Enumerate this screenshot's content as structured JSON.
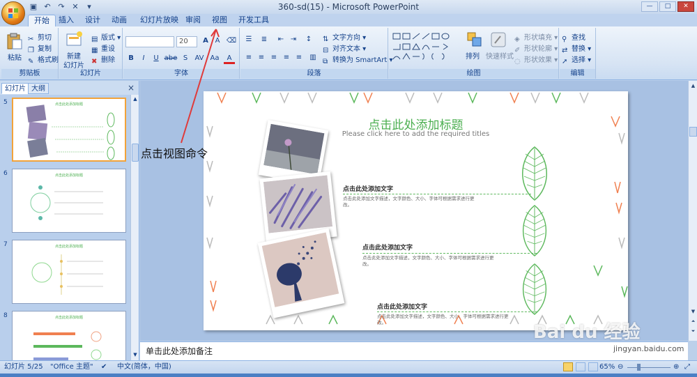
{
  "window": {
    "title": "360-sd(15) - Microsoft PowerPoint"
  },
  "tabs": [
    "开始",
    "插入",
    "设计",
    "动画",
    "幻灯片放映",
    "审阅",
    "视图",
    "开发工具"
  ],
  "ribbon": {
    "clipboard": {
      "label": "剪贴板",
      "paste": "粘贴",
      "cut": "剪切",
      "copy": "复制",
      "format_painter": "格式刷"
    },
    "slides": {
      "label": "幻灯片",
      "new_slide": "新建",
      "new_slide2": "幻灯片",
      "layout": "版式",
      "reset": "重设",
      "delete": "删除"
    },
    "font": {
      "label": "字体",
      "font_size": "20",
      "bold": "B",
      "italic": "I",
      "underline": "U",
      "strike": "abe",
      "shadow": "S",
      "spacing": "AV",
      "case": "Aa",
      "color": "A"
    },
    "paragraph": {
      "label": "段落",
      "text_direction": "文字方向",
      "align_text": "对齐文本",
      "smartart": "转换为 SmartArt"
    },
    "drawing": {
      "label": "绘图",
      "arrange": "排列",
      "quick_styles": "快速样式",
      "shape_fill": "形状填充",
      "shape_outline": "形状轮廓",
      "shape_effects": "形状效果"
    },
    "editing": {
      "label": "编辑",
      "find": "查找",
      "replace": "替换",
      "select": "选择"
    }
  },
  "left_panel": {
    "tabs": [
      "幻灯片",
      "大纲"
    ],
    "close": "×",
    "thumbs": [
      {
        "num": "5",
        "selected": true
      },
      {
        "num": "6",
        "selected": false
      },
      {
        "num": "7",
        "selected": false
      },
      {
        "num": "8",
        "selected": false
      }
    ]
  },
  "slide": {
    "title": "点击此处添加标题",
    "subtitle": "Please click here to add the required titles",
    "items": [
      {
        "title": "点击此处添加文字",
        "desc": "点击此处添加文字描述，文字颜色、大小、字体可根据需求进行更改。"
      },
      {
        "title": "点击此处添加文字",
        "desc": "点击此处添加文字描述，文字颜色、大小、字体可根据需求进行更改。"
      },
      {
        "title": "点击此处添加文字",
        "desc": "点击此处添加文字描述，文字颜色、大小、字体可根据需求进行更改。"
      }
    ]
  },
  "notes": {
    "placeholder": "单击此处添加备注"
  },
  "status": {
    "slide_info": "幻灯片 5/25",
    "theme": "\"Office 主题\"",
    "language": "中文(简体，中国)",
    "zoom": "65%"
  },
  "annotation": {
    "text": "点击视图命令"
  },
  "watermark": {
    "brand": "Bai du 经验",
    "url": "jingyan.baidu.com"
  },
  "colors": {
    "accent_green": "#4caf50",
    "selected_thumb": "#f2a33a",
    "arrow": "#e03a3a"
  }
}
